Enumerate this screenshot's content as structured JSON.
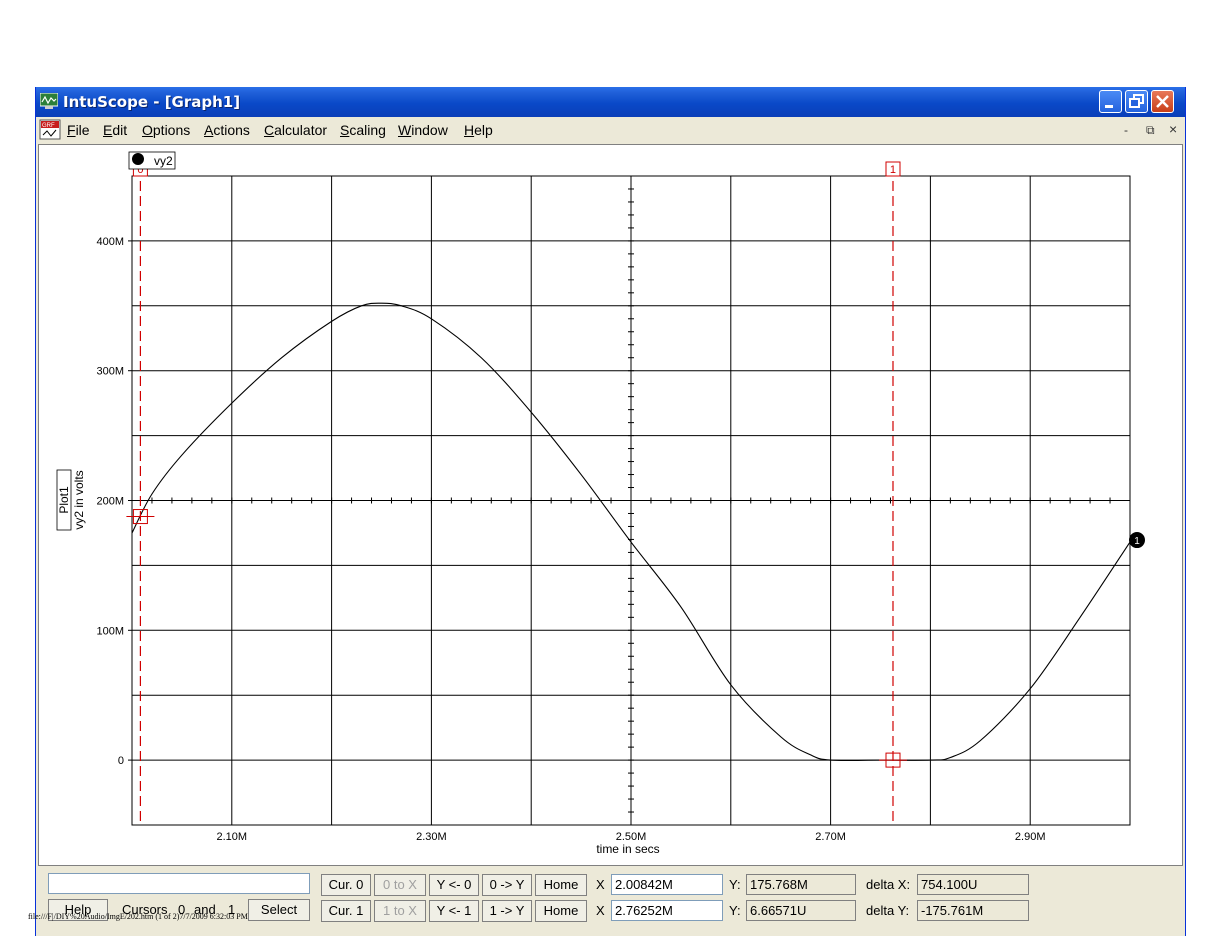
{
  "window": {
    "title": "IntuScope - [Graph1]",
    "colors": {
      "titlebar": "#0a49c8",
      "face": "#ece9d8",
      "trace": "#000000",
      "cursor": "#d00000"
    }
  },
  "menu": {
    "items": [
      {
        "label": "File",
        "u": "F",
        "rest": "ile"
      },
      {
        "label": "Edit",
        "u": "E",
        "rest": "dit"
      },
      {
        "label": "Options",
        "u": "O",
        "rest": "ptions"
      },
      {
        "label": "Actions",
        "u": "A",
        "rest": "ctions"
      },
      {
        "label": "Calculator",
        "u": "C",
        "rest": "alculator"
      },
      {
        "label": "Scaling",
        "u": "S",
        "rest": "caling"
      },
      {
        "label": "Window",
        "u": "W",
        "rest": "indow"
      },
      {
        "label": "Help",
        "u": "H",
        "rest": "elp"
      }
    ],
    "mdi": {
      "minimize": "-",
      "restore": "⧉",
      "close": "×"
    }
  },
  "chart_data": {
    "type": "line",
    "legend_label": "vy2",
    "plot_label": "Plot1",
    "ylabel": "vy2 in volts",
    "xlabel": "time in secs",
    "xlim": [
      2.0,
      3.0
    ],
    "ylim": [
      -0.05,
      0.45
    ],
    "x_tick_labels": [
      "2.10M",
      "2.30M",
      "2.50M",
      "2.70M",
      "2.90M"
    ],
    "x_tick_values": [
      2.1,
      2.3,
      2.5,
      2.7,
      2.9
    ],
    "y_tick_labels": [
      "0",
      "100M",
      "200M",
      "300M",
      "400M"
    ],
    "y_tick_values": [
      0,
      0.1,
      0.2,
      0.3,
      0.4
    ],
    "grid": true,
    "series": [
      {
        "name": "vy2",
        "x": [
          2.0,
          2.02,
          2.05,
          2.1,
          2.15,
          2.2,
          2.23,
          2.25,
          2.27,
          2.3,
          2.35,
          2.4,
          2.45,
          2.5,
          2.55,
          2.6,
          2.65,
          2.68,
          2.7,
          2.75,
          2.8,
          2.82,
          2.85,
          2.9,
          2.95,
          3.0
        ],
        "y": [
          0.175,
          0.205,
          0.235,
          0.275,
          0.31,
          0.338,
          0.35,
          0.352,
          0.35,
          0.34,
          0.31,
          0.268,
          0.22,
          0.168,
          0.118,
          0.058,
          0.018,
          0.004,
          0.0,
          0.0,
          0.0,
          0.002,
          0.015,
          0.055,
          0.11,
          0.168
        ]
      }
    ],
    "cursors": [
      {
        "id": "0",
        "x": 2.00842
      },
      {
        "id": "1",
        "x": 2.76252
      }
    ],
    "end_marker": "1"
  },
  "panel": {
    "text_field": "",
    "help_label": "Help",
    "cursors_label": "Cursors",
    "cursors_a": "0",
    "and_label": "and",
    "cursors_b": "1",
    "select_label": "Select",
    "row0": {
      "cur": "Cur. 0",
      "to_x": "0 to X",
      "y_from": "Y <- 0",
      "to_y": "0 -> Y",
      "home": "Home",
      "x_label": "X",
      "x_value": "2.00842M",
      "y_label": "Y:",
      "y_value": "175.768M",
      "delta_label": "delta X:",
      "delta_value": "754.100U"
    },
    "row1": {
      "cur": "Cur. 1",
      "to_x": "1 to X",
      "y_from": "Y <- 1",
      "to_y": "1 -> Y",
      "home": "Home",
      "x_label": "X",
      "x_value": "2.76252M",
      "y_label": "Y:",
      "y_value": "6.66571U",
      "delta_label": "delta Y:",
      "delta_value": "-175.761M"
    }
  },
  "footer": {
    "url": "file:///F|/DIY%20Audio/ImgE/202.htm (1 of 2)7/7/2009 6:32:03 PM"
  }
}
